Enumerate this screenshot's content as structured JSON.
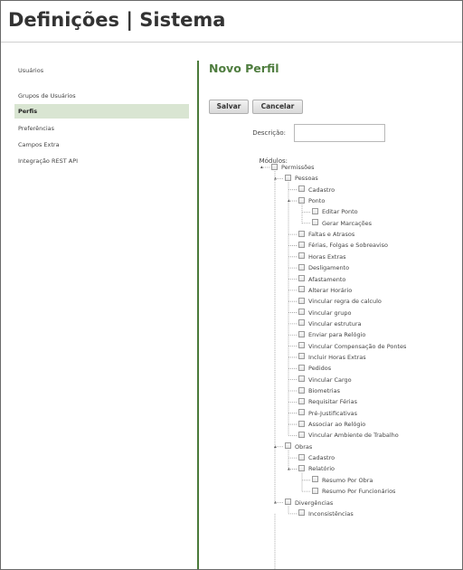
{
  "header": {
    "title": "Definições | Sistema"
  },
  "sidebar": {
    "items": [
      {
        "label": "Usuários",
        "active": false
      },
      {
        "label": "Grupos de Usuários",
        "active": false
      },
      {
        "label": "Perfis",
        "active": true
      },
      {
        "label": "Preferências",
        "active": false
      },
      {
        "label": "Campos Extra",
        "active": false
      },
      {
        "label": "Integração REST API",
        "active": false
      }
    ]
  },
  "main": {
    "title": "Novo Perfil",
    "buttons": {
      "save": "Salvar",
      "cancel": "Cancelar"
    },
    "fields": {
      "description_label": "Descrição:",
      "description_value": "",
      "modules_label": "Módulos:"
    },
    "tree": [
      {
        "label": "Permissões",
        "level": 0,
        "toggle": "expanded"
      },
      {
        "label": "Pessoas",
        "level": 1,
        "toggle": "expanded"
      },
      {
        "label": "Cadastro",
        "level": 2,
        "toggle": "leaf"
      },
      {
        "label": "Ponto",
        "level": 2,
        "toggle": "expanded"
      },
      {
        "label": "Editar Ponto",
        "level": 3,
        "toggle": "leaf"
      },
      {
        "label": "Gerar Marcações",
        "level": 3,
        "toggle": "leaf"
      },
      {
        "label": "Faltas e Atrasos",
        "level": 2,
        "toggle": "leaf"
      },
      {
        "label": "Férias, Folgas e Sobreaviso",
        "level": 2,
        "toggle": "leaf"
      },
      {
        "label": "Horas Extras",
        "level": 2,
        "toggle": "leaf"
      },
      {
        "label": "Desligamento",
        "level": 2,
        "toggle": "leaf"
      },
      {
        "label": "Afastamento",
        "level": 2,
        "toggle": "leaf"
      },
      {
        "label": "Alterar Horário",
        "level": 2,
        "toggle": "leaf"
      },
      {
        "label": "Vincular regra de calculo",
        "level": 2,
        "toggle": "leaf"
      },
      {
        "label": "Vincular grupo",
        "level": 2,
        "toggle": "leaf"
      },
      {
        "label": "Vincular estrutura",
        "level": 2,
        "toggle": "leaf"
      },
      {
        "label": "Enviar para Relógio",
        "level": 2,
        "toggle": "leaf"
      },
      {
        "label": "Vincular Compensação de Pontes",
        "level": 2,
        "toggle": "leaf"
      },
      {
        "label": "Incluir Horas Extras",
        "level": 2,
        "toggle": "leaf"
      },
      {
        "label": "Pedidos",
        "level": 2,
        "toggle": "leaf"
      },
      {
        "label": "Vincular Cargo",
        "level": 2,
        "toggle": "leaf"
      },
      {
        "label": "Biometrias",
        "level": 2,
        "toggle": "leaf"
      },
      {
        "label": "Requisitar Férias",
        "level": 2,
        "toggle": "leaf"
      },
      {
        "label": "Pré-Justificativas",
        "level": 2,
        "toggle": "leaf"
      },
      {
        "label": "Associar ao Relógio",
        "level": 2,
        "toggle": "leaf"
      },
      {
        "label": "Vincular Ambiente de Trabalho",
        "level": 2,
        "toggle": "leaf"
      },
      {
        "label": "Obras",
        "level": 1,
        "toggle": "expanded"
      },
      {
        "label": "Cadastro",
        "level": 2,
        "toggle": "leaf"
      },
      {
        "label": "Relatório",
        "level": 2,
        "toggle": "expanded"
      },
      {
        "label": "Resumo Por Obra",
        "level": 3,
        "toggle": "leaf"
      },
      {
        "label": "Resumo Por Funcionários",
        "level": 3,
        "toggle": "leaf"
      },
      {
        "label": "Divergências",
        "level": 1,
        "toggle": "expanded"
      },
      {
        "label": "Inconsistências",
        "level": 2,
        "toggle": "leaf"
      }
    ]
  },
  "colors": {
    "accent": "#4f7d3f",
    "active_bg": "#d9e5d2",
    "divider": "#4a7a3a"
  }
}
